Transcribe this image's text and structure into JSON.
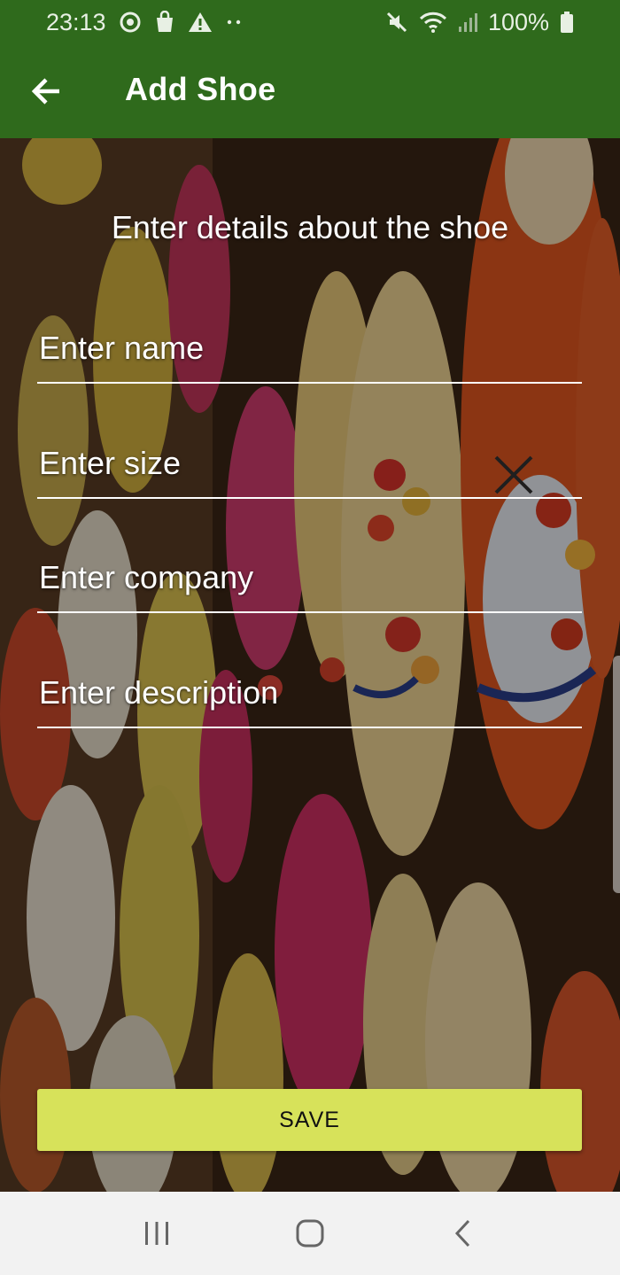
{
  "status_bar": {
    "time": "23:13",
    "battery": "100%",
    "icons_left": [
      "sync-icon",
      "shopping-bag-icon",
      "warning-icon",
      "more-dots-icon"
    ],
    "icons_right": [
      "mute-icon",
      "wifi-icon",
      "signal-icon",
      "battery-icon"
    ]
  },
  "app_bar": {
    "title": "Add Shoe",
    "back_icon": "arrow-back-icon",
    "color": "#2f6a1c"
  },
  "form": {
    "heading": "Enter details about the shoe",
    "fields": {
      "name": {
        "placeholder": "Enter name",
        "value": ""
      },
      "size": {
        "placeholder": "Enter size",
        "value": ""
      },
      "company": {
        "placeholder": "Enter company",
        "value": ""
      },
      "description": {
        "placeholder": "Enter description",
        "value": ""
      }
    },
    "save_label": "SAVE",
    "save_color": "#d7e25a"
  },
  "nav_bar": {
    "recents_icon": "recent-apps-icon",
    "home_icon": "home-icon",
    "back_icon": "nav-back-icon"
  }
}
